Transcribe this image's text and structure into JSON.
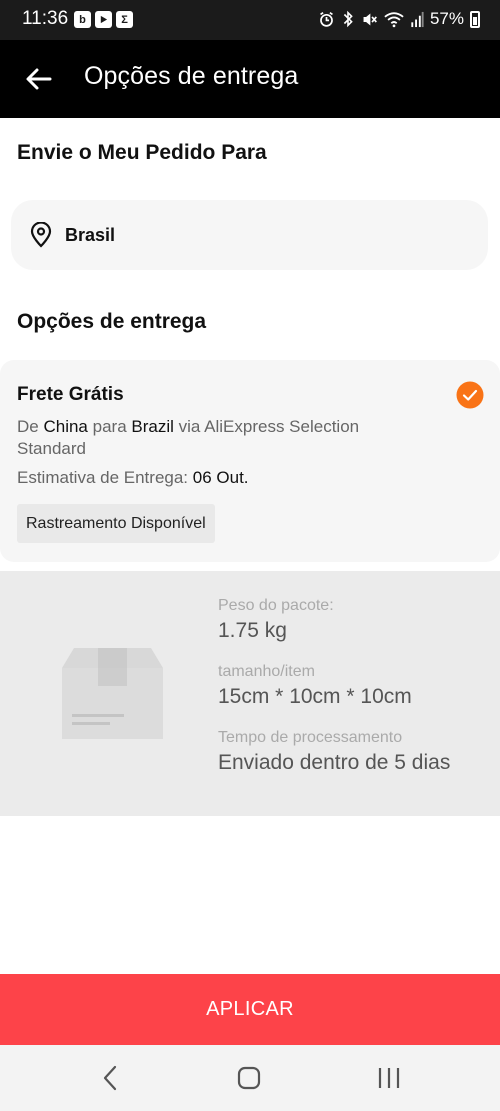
{
  "status_bar": {
    "time": "11:36",
    "battery": "57%",
    "left_icons": [
      "notification-b-icon",
      "youtube-icon",
      "sigma-app-icon"
    ],
    "right_icons": [
      "alarm-icon",
      "bluetooth-icon",
      "mute-icon",
      "wifi-icon",
      "signal-icon",
      "battery-icon"
    ]
  },
  "header": {
    "title": "Opções de entrega"
  },
  "destination": {
    "section_title": "Envie o Meu Pedido Para",
    "country": "Brasil"
  },
  "shipping": {
    "section_title": "Opções de entrega",
    "option": {
      "title": "Frete Grátis",
      "route_prefix": "De",
      "route_from": "China",
      "route_mid": "para",
      "route_to": "Brazil",
      "route_suffix": "via AliExpress Selection Standard",
      "estimate_label": "Estimativa de Entrega:",
      "estimate_value": "06 Out.",
      "tracking_badge": "Rastreamento Disponível",
      "selected": true
    }
  },
  "package": {
    "weight_label": "Peso do pacote:",
    "weight_value": "1.75 kg",
    "size_label": "tamanho/item",
    "size_value": "15cm * 10cm * 10cm",
    "processing_label": "Tempo de processamento",
    "processing_value": "Enviado dentro de 5 dias"
  },
  "apply_button": {
    "label": "APLICAR"
  },
  "colors": {
    "accent_orange": "#f97316",
    "apply_red": "#fd4349",
    "header_black": "#000000"
  }
}
